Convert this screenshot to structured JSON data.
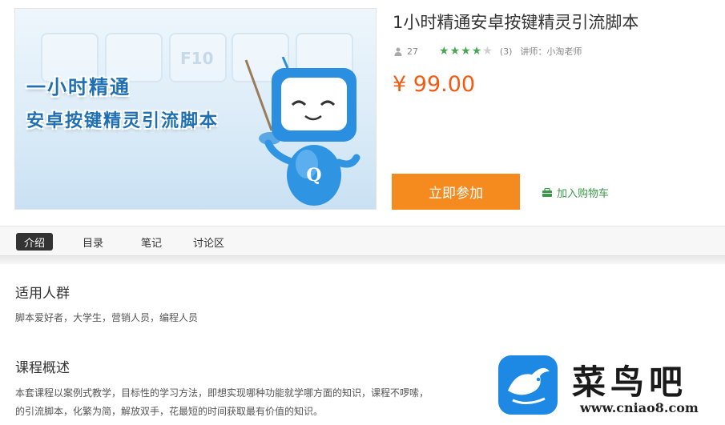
{
  "cover": {
    "key_label": "F10",
    "line1": "一小时精通",
    "line2": "安卓按键精灵引流脚本",
    "mascot_letter": "Q"
  },
  "course": {
    "title": "1小时精通安卓按键精灵引流脚本",
    "learners": "27",
    "rating": 4,
    "rating_max": 5,
    "rating_count": "(3)",
    "teacher": "讲师：小淘老师",
    "price": "¥ 99.00"
  },
  "actions": {
    "join_label": "立即参加",
    "cart_label": "加入购物车"
  },
  "tabs": [
    {
      "label": "介绍",
      "active": true
    },
    {
      "label": "目录",
      "active": false
    },
    {
      "label": "笔记",
      "active": false
    },
    {
      "label": "讨论区",
      "active": false
    }
  ],
  "audience": {
    "heading": "适用人群",
    "text": "脚本爱好者，大学生，营销人员，编程人员"
  },
  "overview": {
    "heading": "课程概述",
    "line1": "本套课程以案例式教学，目标性的学习方法，即想实现哪种功能就学哪方面的知识，课程不啰嗦，",
    "line2": "的引流脚本，化繁为简，解放双手，花最短的时间获取最有价值的知识。"
  },
  "watermark": {
    "title": "菜鸟吧",
    "url": "www.cniao8.com"
  },
  "colors": {
    "accent": "#f58a1e",
    "price": "#f25a12",
    "star": "#4ba555",
    "cart": "#3a9a48",
    "brand_blue": "#1e88e5"
  }
}
